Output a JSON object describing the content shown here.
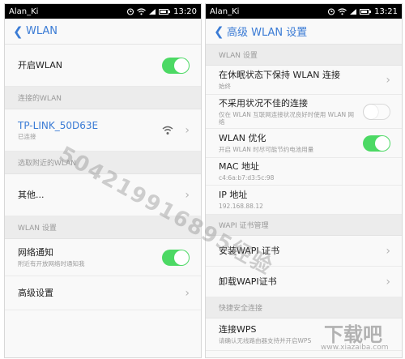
{
  "left": {
    "status": {
      "carrier": "Alan_Ki",
      "time": "13:20"
    },
    "title": "WLAN",
    "wlan_switch_label": "开启WLAN",
    "sections": {
      "connected": "连接的WLAN",
      "nearby": "选取附近的WLAN",
      "settings": "WLAN 设置"
    },
    "connected_network": {
      "ssid": "TP-LINK_50D63E",
      "status": "已连接"
    },
    "other_label": "其他...",
    "network_notify": {
      "label": "网络通知",
      "sub": "附近有开放网络时通知我"
    },
    "advanced_label": "高级设置"
  },
  "right": {
    "status": {
      "carrier": "Alan_Ki",
      "time": "13:21"
    },
    "title": "高级 WLAN 设置",
    "sections": {
      "wlan": "WLAN 设置",
      "wapi": "WAPI 证书管理",
      "quick": "快捷安全连接"
    },
    "keep_connected": {
      "label": "在休眠状态下保持 WLAN 连接",
      "sub": "始终"
    },
    "avoid_poor": {
      "label": "不采用状况不佳的连接",
      "sub": "仅在 WLAN 互联网连接状况良好时使用 WLAN 网络"
    },
    "optimize": {
      "label": "WLAN 优化",
      "sub": "开启 WLAN 时尽可能节约电池用量"
    },
    "mac": {
      "label": "MAC 地址",
      "value": "c4:6a:b7:d3:5c:98"
    },
    "ip": {
      "label": "IP 地址",
      "value": "192.168.88.12"
    },
    "install_cert": "安装WAPI 证书",
    "uninstall_cert": "卸载WAPI证书",
    "wps": {
      "label": "连接WPS",
      "sub": "请确认无线路由器支持并开启WPS"
    }
  },
  "toggles": {
    "left_wlan": true,
    "left_notify": true,
    "right_avoid": false,
    "right_optimize": true
  },
  "watermark": {
    "diagonal": "504219916895经验",
    "logo": "下载吧",
    "site": "www.xiazaiba.com"
  },
  "colors": {
    "accent": "#3a7bd5",
    "toggle_on": "#4cd964",
    "section_bg": "#ececec"
  }
}
